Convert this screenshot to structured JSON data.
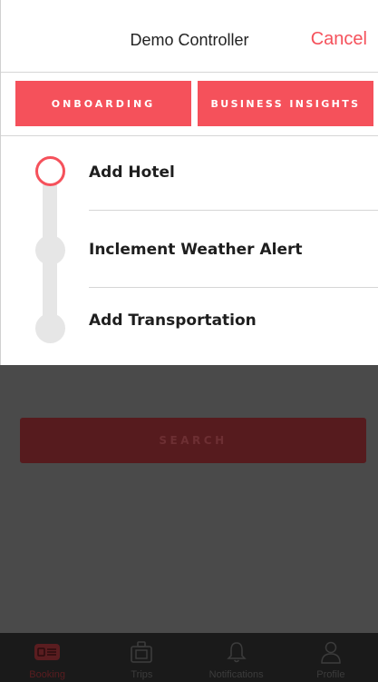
{
  "modal": {
    "title": "Demo Controller",
    "cancel_label": "Cancel",
    "segments": [
      "ONBOARDING",
      "BUSINESS INSIGHTS"
    ],
    "steps": [
      {
        "label": "Add Hotel",
        "active": true
      },
      {
        "label": "Inclement Weather Alert",
        "active": false
      },
      {
        "label": "Add Transportation",
        "active": false
      }
    ]
  },
  "background": {
    "search_label": "SEARCH",
    "tabs": [
      {
        "label": "Booking",
        "icon": "booking-icon",
        "active": true
      },
      {
        "label": "Trips",
        "icon": "suitcase-icon",
        "active": false
      },
      {
        "label": "Notifications",
        "icon": "bell-icon",
        "active": false
      },
      {
        "label": "Profile",
        "icon": "person-icon",
        "active": false
      }
    ]
  },
  "colors": {
    "accent": "#f5515b",
    "overlay": "#4a4a4a",
    "tabbar": "#1a1a1a"
  }
}
